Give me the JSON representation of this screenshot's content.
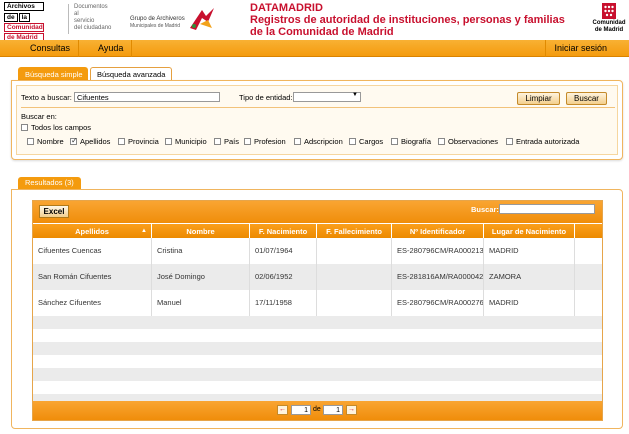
{
  "header": {
    "logo_lines": [
      "Archivos",
      "de",
      "la",
      "Comunidad",
      "de Madrid"
    ],
    "docs_lines": [
      "Documentos",
      "al",
      "servicio",
      "del ciudadano"
    ],
    "grupo_line1": "Grupo de Archiveros",
    "grupo_line2": "Municipales de Madrid",
    "title_main": "DATAMADRID",
    "title_sub1": "Registros de autoridad de instituciones, personas y familias",
    "title_sub2": "de la Comunidad de Madrid",
    "cm_line1": "Comunidad",
    "cm_line2": "de Madrid"
  },
  "nav": {
    "consultas": "Consultas",
    "ayuda": "Ayuda",
    "login": "Iniciar sesión"
  },
  "search": {
    "tabs": [
      "Búsqueda simple",
      "Búsqueda avanzada"
    ],
    "texto_label": "Texto a buscar:",
    "texto_value": "Cifuentes",
    "tipo_label": "Tipo de entidad:",
    "tipo_value": "",
    "limpiar": "Limpiar",
    "buscar": "Buscar",
    "buscar_en": "Buscar en:",
    "todos": "Todos los campos",
    "fields": [
      {
        "label": "Nombre",
        "checked": false
      },
      {
        "label": "Apellidos",
        "checked": true
      },
      {
        "label": "Provincia",
        "checked": false
      },
      {
        "label": "Municipio",
        "checked": false
      },
      {
        "label": "País",
        "checked": false
      },
      {
        "label": "Profesion",
        "checked": false
      },
      {
        "label": "Adscripcion",
        "checked": false
      },
      {
        "label": "Cargos",
        "checked": false
      },
      {
        "label": "Biografía",
        "checked": false
      },
      {
        "label": "Observaciones",
        "checked": false
      },
      {
        "label": "Entrada autorizada",
        "checked": false
      }
    ]
  },
  "results": {
    "tab_label": "Resultados (3)",
    "excel": "Excel",
    "search_label": "Buscar:",
    "search_value": "",
    "columns": [
      "Apellidos",
      "Nombre",
      "F. Nacimiento",
      "F. Fallecimiento",
      "Nº Identificador",
      "Lugar de Nacimiento"
    ],
    "rows": [
      [
        "Cifuentes Cuencas",
        "Cristina",
        "01/07/1964",
        "",
        "ES-280796CM/RA000213",
        "MADRID"
      ],
      [
        "San Román Cifuentes",
        "José Domingo",
        "02/06/1952",
        "",
        "ES-281816AM/RA000042",
        "ZAMORA"
      ],
      [
        "Sánchez Cifuentes",
        "Manuel",
        "17/11/1958",
        "",
        "ES-280796CM/RA000276",
        "MADRID"
      ]
    ],
    "pager": {
      "page": "1",
      "of_label": "de",
      "total": "1"
    }
  },
  "colors": {
    "accent": "#f49b0e",
    "brand_red": "#c8102e"
  }
}
